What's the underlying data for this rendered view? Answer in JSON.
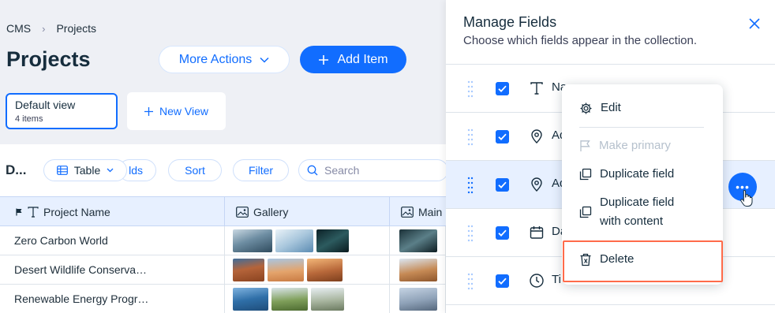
{
  "breadcrumb": {
    "root": "CMS",
    "current": "Projects"
  },
  "page": {
    "title": "Projects"
  },
  "actions": {
    "more_label": "More Actions",
    "add_label": "Add Item"
  },
  "views": {
    "default": {
      "title": "Default view",
      "count": "4 items"
    },
    "new_label": "New View"
  },
  "toolbar": {
    "collection_short": "D...",
    "table_label": "Table",
    "fields_label": "lds",
    "sort_label": "Sort",
    "filter_label": "Filter",
    "search_placeholder": "Search"
  },
  "table": {
    "columns": [
      "Project Name",
      "Gallery",
      "Main"
    ],
    "rows": [
      {
        "name": "Zero Carbon World"
      },
      {
        "name": "Desert Wildlife Conserva…"
      },
      {
        "name": "Renewable Energy Progr…"
      }
    ]
  },
  "panel": {
    "title": "Manage Fields",
    "subtitle": "Choose which fields appear in the collection.",
    "fields": [
      {
        "label": "Na",
        "icon": "text-icon",
        "checked": true
      },
      {
        "label": "Ad",
        "icon": "location-icon",
        "checked": true
      },
      {
        "label": "Ad",
        "icon": "location-icon",
        "checked": true
      },
      {
        "label": "Da",
        "icon": "calendar-icon",
        "checked": true
      },
      {
        "label": "Ti",
        "icon": "clock-icon",
        "checked": true
      }
    ]
  },
  "menu": {
    "edit": "Edit",
    "make_primary": "Make primary",
    "duplicate": "Duplicate field",
    "duplicate_content_1": "Duplicate field",
    "duplicate_content_2": "with content",
    "delete": "Delete"
  },
  "colors": {
    "accent": "#116dff",
    "highlight": "#ff6b4a",
    "row_highlight": "#e7f0ff"
  }
}
